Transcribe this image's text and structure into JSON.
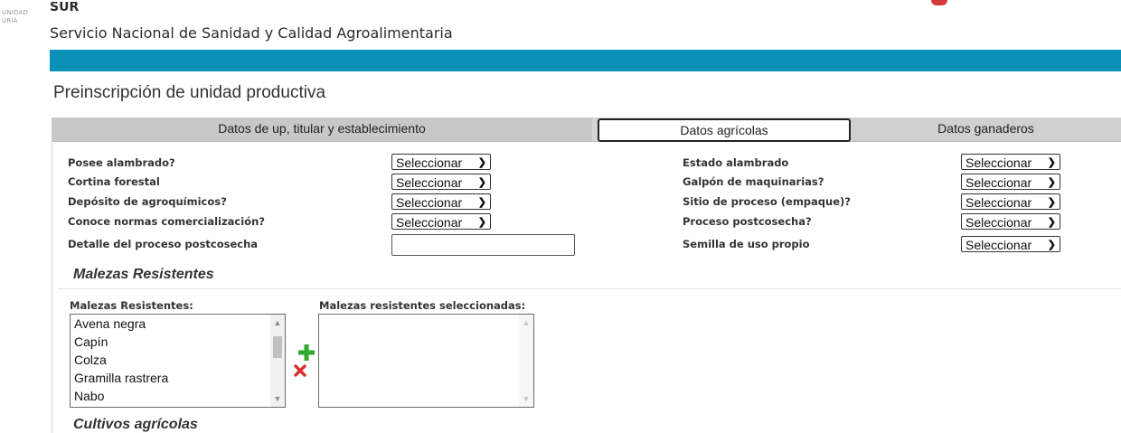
{
  "header": {
    "logo_small_lines": [
      "UNIDAD",
      "URIA"
    ],
    "org_abbr": "SUR",
    "org_name": "Servicio Nacional de Sanidad y Calidad Agroalimentaria"
  },
  "page_title": "Preinscripción de unidad productiva",
  "tabs": [
    {
      "label": "Datos de up, titular y establecimiento",
      "active": false
    },
    {
      "label": "Datos agrícolas",
      "active": true
    },
    {
      "label": "Datos ganaderos",
      "active": false
    }
  ],
  "form": {
    "left": [
      {
        "label": "Posee alambrado?",
        "value": "Seleccionar"
      },
      {
        "label": "Cortina forestal",
        "value": "Seleccionar"
      },
      {
        "label": "Depósito de agroquímicos?",
        "value": "Seleccionar"
      },
      {
        "label": "Conoce normas comercialización?",
        "value": "Seleccionar"
      },
      {
        "label": "Detalle del proceso postcosecha",
        "value": ""
      }
    ],
    "right": [
      {
        "label": "Estado alambrado",
        "value": "Seleccionar"
      },
      {
        "label": "Galpón de maquinarias?",
        "value": "Seleccionar"
      },
      {
        "label": "Sitio de proceso (empaque)?",
        "value": "Seleccionar"
      },
      {
        "label": "Proceso postcosecha?",
        "value": "Seleccionar"
      },
      {
        "label": "Semilla de uso propio",
        "value": "Seleccionar"
      }
    ]
  },
  "malezas": {
    "section_title": "Malezas Resistentes",
    "available_label": "Malezas Resistentes:",
    "selected_label": "Malezas resistentes seleccionadas:",
    "available_items": [
      "Avena negra",
      "Capín",
      "Colza",
      "Gramilla rastrera",
      "Nabo"
    ],
    "selected_items": []
  },
  "cultivos": {
    "section_title": "Cultivos agrícolas"
  },
  "colors": {
    "accent_bar": "#0a8fb8",
    "add_icon": "#2eaa2e",
    "remove_icon": "#d93030"
  }
}
